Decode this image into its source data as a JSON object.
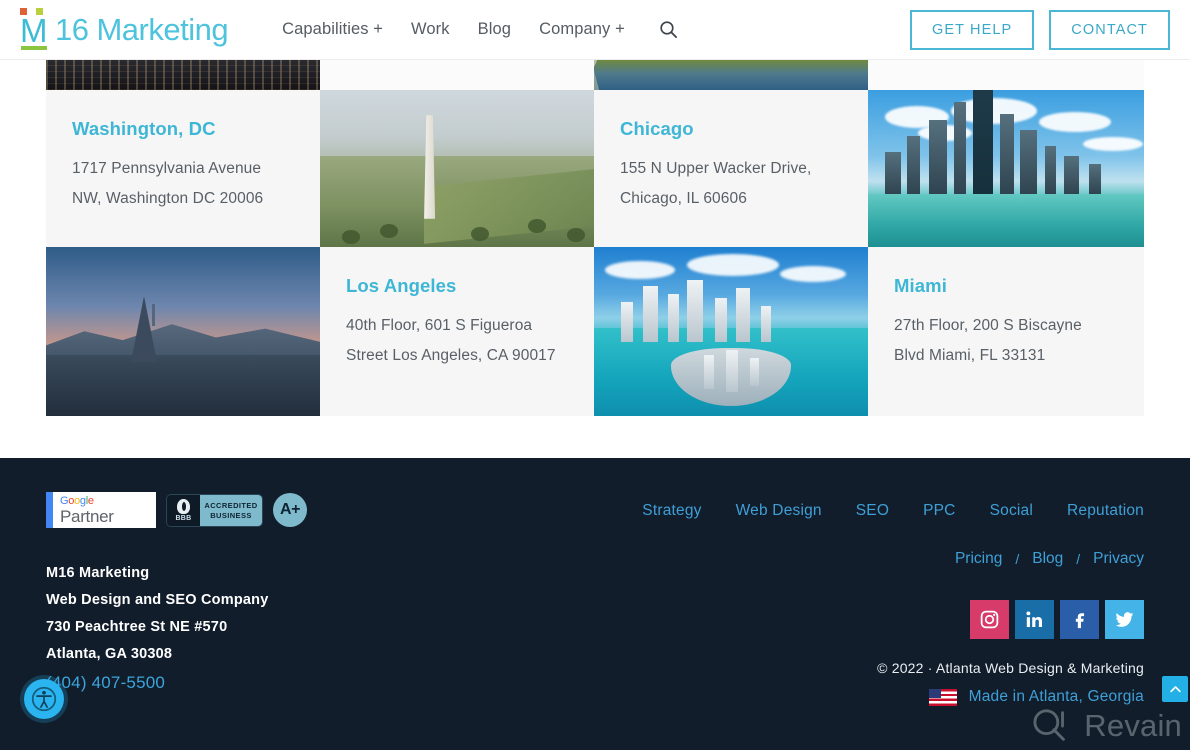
{
  "header": {
    "logo": {
      "prefix": "M",
      "sub": "16",
      "word": "Marketing",
      "full": "M16 Marketing"
    },
    "nav": [
      {
        "label": "Capabilities +"
      },
      {
        "label": "Work"
      },
      {
        "label": "Blog"
      },
      {
        "label": "Company +"
      }
    ],
    "search_icon": "search-icon",
    "actions": [
      {
        "label": "GET HELP"
      },
      {
        "label": "CONTACT"
      }
    ],
    "accent_color": "#4bb7d4"
  },
  "locations": {
    "accent_color": "#3eb6d6",
    "cards": [
      {
        "city": "Washington, DC",
        "address_line1": "1717 Pennsylvania Avenue",
        "address_line2": "NW, Washington DC 20006",
        "photo": "washington-monument-photo"
      },
      {
        "city": "Chicago",
        "address_line1": "155 N Upper Wacker Drive,",
        "address_line2": "Chicago, IL 60606",
        "photo": "chicago-skyline-photo"
      },
      {
        "city": "Los Angeles",
        "address_line1": "40th Floor, 601 S Figueroa",
        "address_line2": "Street Los Angeles, CA 90017",
        "photo": "los-angeles-dusk-photo"
      },
      {
        "city": "Miami",
        "address_line1": "27th Floor, 200 S Biscayne",
        "address_line2": "Blvd Miami, FL 33131",
        "photo": "miami-bay-photo"
      }
    ]
  },
  "footer": {
    "background_color": "#111d2b",
    "link_color": "#3f9fd6",
    "badges": {
      "google": {
        "word": "Google",
        "letters": [
          "G",
          "o",
          "o",
          "g",
          "l",
          "e"
        ],
        "label": "Partner"
      },
      "bbb": {
        "mark": "BBB",
        "line1": "ACCREDITED",
        "line2": "BUSINESS"
      },
      "rating": {
        "label": "A+"
      }
    },
    "address": {
      "name": "M16 Marketing",
      "tagline": "Web Design and SEO Company",
      "street": "730 Peachtree St NE #570",
      "city": "Atlanta, GA 30308",
      "phone": "(404) 407-5500"
    },
    "links_primary": [
      {
        "label": "Strategy"
      },
      {
        "label": "Web Design"
      },
      {
        "label": "SEO"
      },
      {
        "label": "PPC"
      },
      {
        "label": "Social"
      },
      {
        "label": "Reputation"
      }
    ],
    "links_secondary": [
      {
        "label": "Pricing"
      },
      {
        "label": "Blog"
      },
      {
        "label": "Privacy"
      }
    ],
    "separator": "/",
    "socials": [
      {
        "name": "instagram",
        "glyph": "◎",
        "color": "#d63b6a"
      },
      {
        "name": "linkedin",
        "glyph": "in",
        "color": "#1a6ea8"
      },
      {
        "name": "facebook",
        "glyph": "f",
        "color": "#2b5ea8"
      },
      {
        "name": "twitter",
        "glyph": "✉",
        "color": "#44b3e8"
      }
    ],
    "copyright": "© 2022 · Atlanta Web Design & Marketing",
    "made_in": "Made in Atlanta, Georgia"
  },
  "overlay": {
    "watermark": "Revain",
    "accessibility_icon": "accessibility-icon",
    "back_to_top_icon": "chevron-up-icon"
  }
}
